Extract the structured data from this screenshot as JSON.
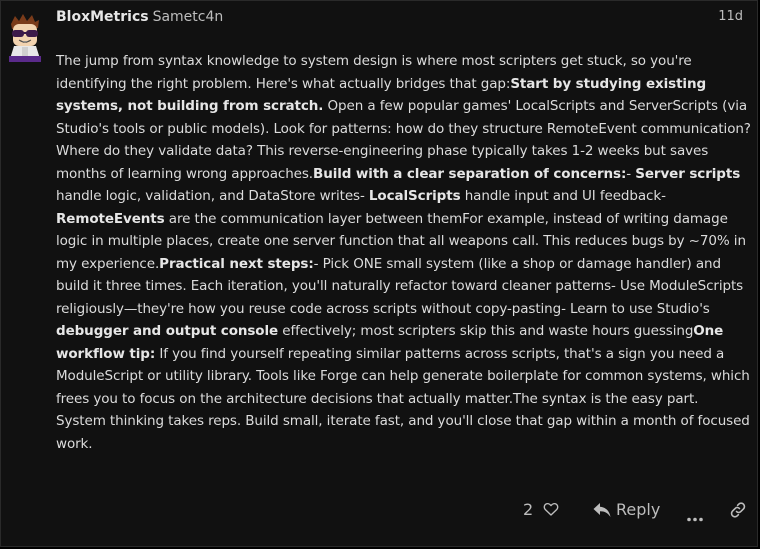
{
  "post": {
    "username": "BloxMetrics",
    "altname": "Sametc4n",
    "date": "11d",
    "body": [
      {
        "t": "The jump from syntax knowledge to system design is where most scripters get stuck, so you're identifying the right problem. Here's what actually bridges that gap:"
      },
      {
        "t": "Start by studying existing systems, not building from scratch.",
        "b": true
      },
      {
        "t": " Open a few popular games' LocalScripts and ServerScripts (via Studio's tools or public models). Look for patterns: how do they structure RemoteEvent communication? Where do they validate data? This reverse-engineering phase typically takes 1-2 weeks but saves months of learning wrong approaches."
      },
      {
        "t": "Build with a clear separation of concerns:",
        "b": true
      },
      {
        "t": "- "
      },
      {
        "t": "Server scripts",
        "b": true
      },
      {
        "t": " handle logic, validation, and DataStore writes- "
      },
      {
        "t": "LocalScripts",
        "b": true
      },
      {
        "t": " handle input and UI feedback- "
      },
      {
        "t": "RemoteEvents",
        "b": true
      },
      {
        "t": " are the communication layer between themFor example, instead of writing damage logic in multiple places, create one server function that all weapons call. This reduces bugs by ~70% in my experience."
      },
      {
        "t": "Practical next steps:",
        "b": true
      },
      {
        "t": "- Pick ONE small system (like a shop or damage handler) and build it three times. Each iteration, you'll naturally refactor toward cleaner patterns- Use ModuleScripts religiously—they're how you reuse code across scripts without copy-pasting- Learn to use Studio's "
      },
      {
        "t": "debugger and output console",
        "b": true
      },
      {
        "t": " effectively; most scripters skip this and waste hours guessing"
      },
      {
        "t": "One workflow tip:",
        "b": true
      },
      {
        "t": " If you find yourself repeating similar patterns across scripts, that's a sign you need a ModuleScript or utility library. Tools like Forge can help generate boilerplate for common systems, which frees you to focus on the architecture decisions that actually matter.The syntax is the easy part. System thinking takes reps. Build small, iterate fast, and you'll close that gap within a month of focused work."
      }
    ]
  },
  "actions": {
    "like_count": "2",
    "reply_label": "Reply",
    "like_icon": "heart-icon",
    "reply_icon": "reply-arrow-icon",
    "more_icon": "ellipsis-icon",
    "link_icon": "link-icon"
  },
  "colors": {
    "background": "#111111",
    "text": "#dcdcdc",
    "muted": "#bdbdbd"
  }
}
